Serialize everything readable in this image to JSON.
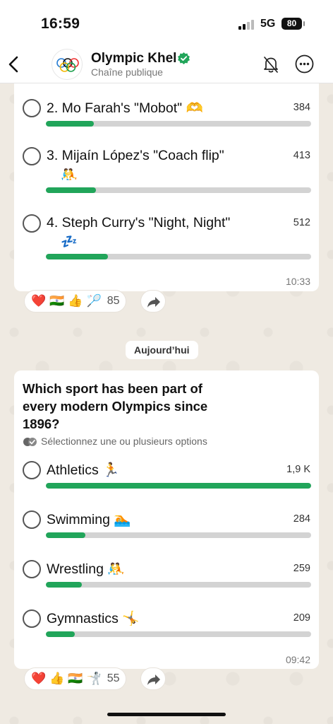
{
  "status_bar": {
    "time": "16:59",
    "network": "5G",
    "battery": "80"
  },
  "header": {
    "back_icon": "chevron-left-icon",
    "title": "Olympic Khel",
    "subtitle": "Chaîne publique",
    "verified_color": "#21a55a",
    "mute_icon": "bell-slash-icon",
    "more_icon": "ellipsis-circle-icon"
  },
  "poll1": {
    "options": [
      {
        "label": "2. Mo Farah's \"Mobot\" 🫶",
        "count": "384",
        "fill": 0.18
      },
      {
        "label": "3. Mijaín López's \"Coach flip\"",
        "extra": "🤼",
        "count": "413",
        "fill": 0.19
      },
      {
        "label": "4. Steph Curry's \"Night, Night\"",
        "extra": "💤",
        "count": "512",
        "fill": 0.235
      }
    ],
    "time": "10:33",
    "reactions": {
      "emojis": [
        "❤️",
        "🇮🇳",
        "👍",
        "🏸"
      ],
      "count": "85"
    }
  },
  "date_chip": "Aujourd’hui",
  "poll2": {
    "question": "Which sport has been part of every modern Olympics since 1896?",
    "hint": "Sélectionnez une ou plusieurs options",
    "options": [
      {
        "label": "Athletics 🏃",
        "count": "1,9 K",
        "fill": 1.0
      },
      {
        "label": "Swimming 🏊",
        "count": "284",
        "fill": 0.15
      },
      {
        "label": "Wrestling 🤼",
        "count": "259",
        "fill": 0.135
      },
      {
        "label": "Gymnastics 🤸",
        "count": "209",
        "fill": 0.11
      }
    ],
    "time": "09:42",
    "reactions": {
      "emojis": [
        "❤️",
        "👍",
        "🇮🇳",
        "🤺"
      ],
      "count": "55"
    }
  },
  "colors": {
    "accent": "#21a55a",
    "track": "#d3d3d3",
    "wallpaper": "#efeae2"
  }
}
